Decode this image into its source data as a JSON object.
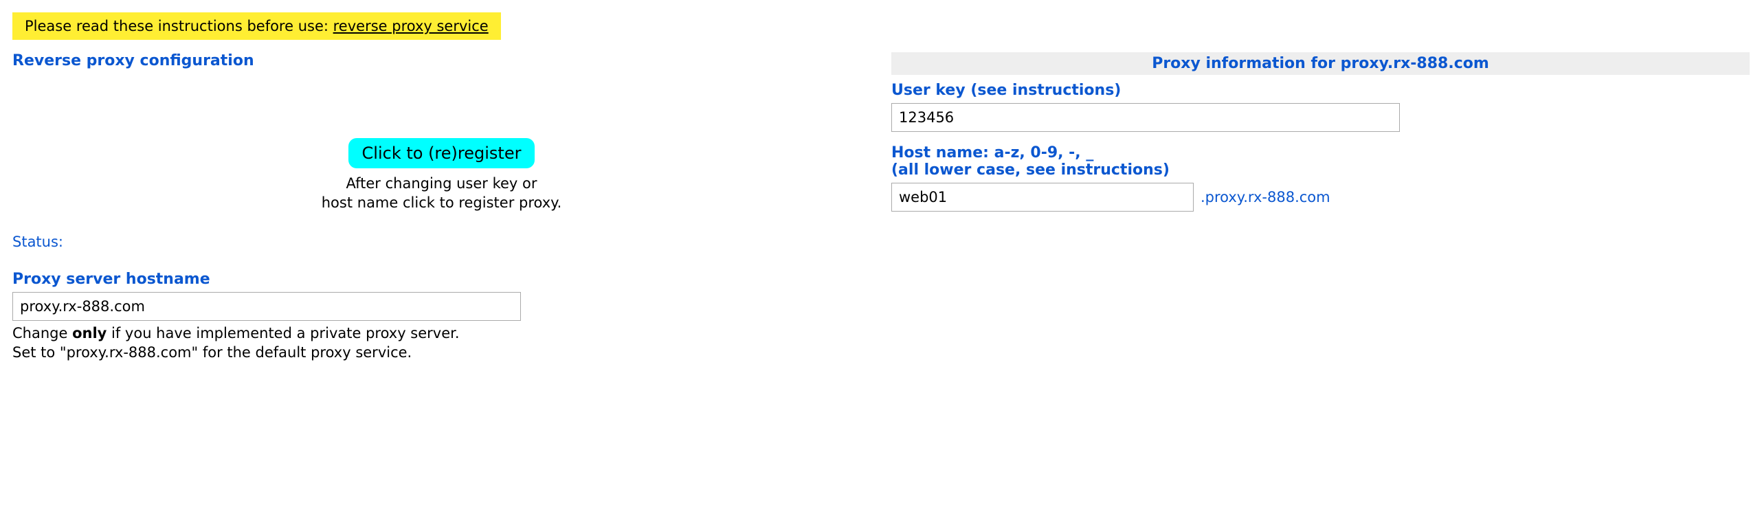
{
  "banner": {
    "prefix": "Please read these instructions before use: ",
    "link_text": "reverse proxy service"
  },
  "left": {
    "title": "Reverse proxy configuration",
    "register_button": "Click to (re)register",
    "register_note_line1": "After changing user key or",
    "register_note_line2": "host name click to register proxy.",
    "status_label": "Status:",
    "proxy_server_title": "Proxy server hostname",
    "proxy_server_value": "proxy.rx-888.com",
    "proxy_server_help_prefix": "Change ",
    "proxy_server_help_bold": "only",
    "proxy_server_help_suffix": " if you have implemented a private proxy server.",
    "proxy_server_help_line2": "Set to \"proxy.rx-888.com\" for the default proxy service."
  },
  "right": {
    "header": "Proxy information for proxy.rx-888.com",
    "user_key_label": "User key (see instructions)",
    "user_key_value": "123456",
    "host_label_line1": "Host name: a-z, 0-9, -, _",
    "host_label_line2": "(all lower case, see instructions)",
    "host_value": "web01",
    "host_suffix": ".proxy.rx-888.com"
  }
}
